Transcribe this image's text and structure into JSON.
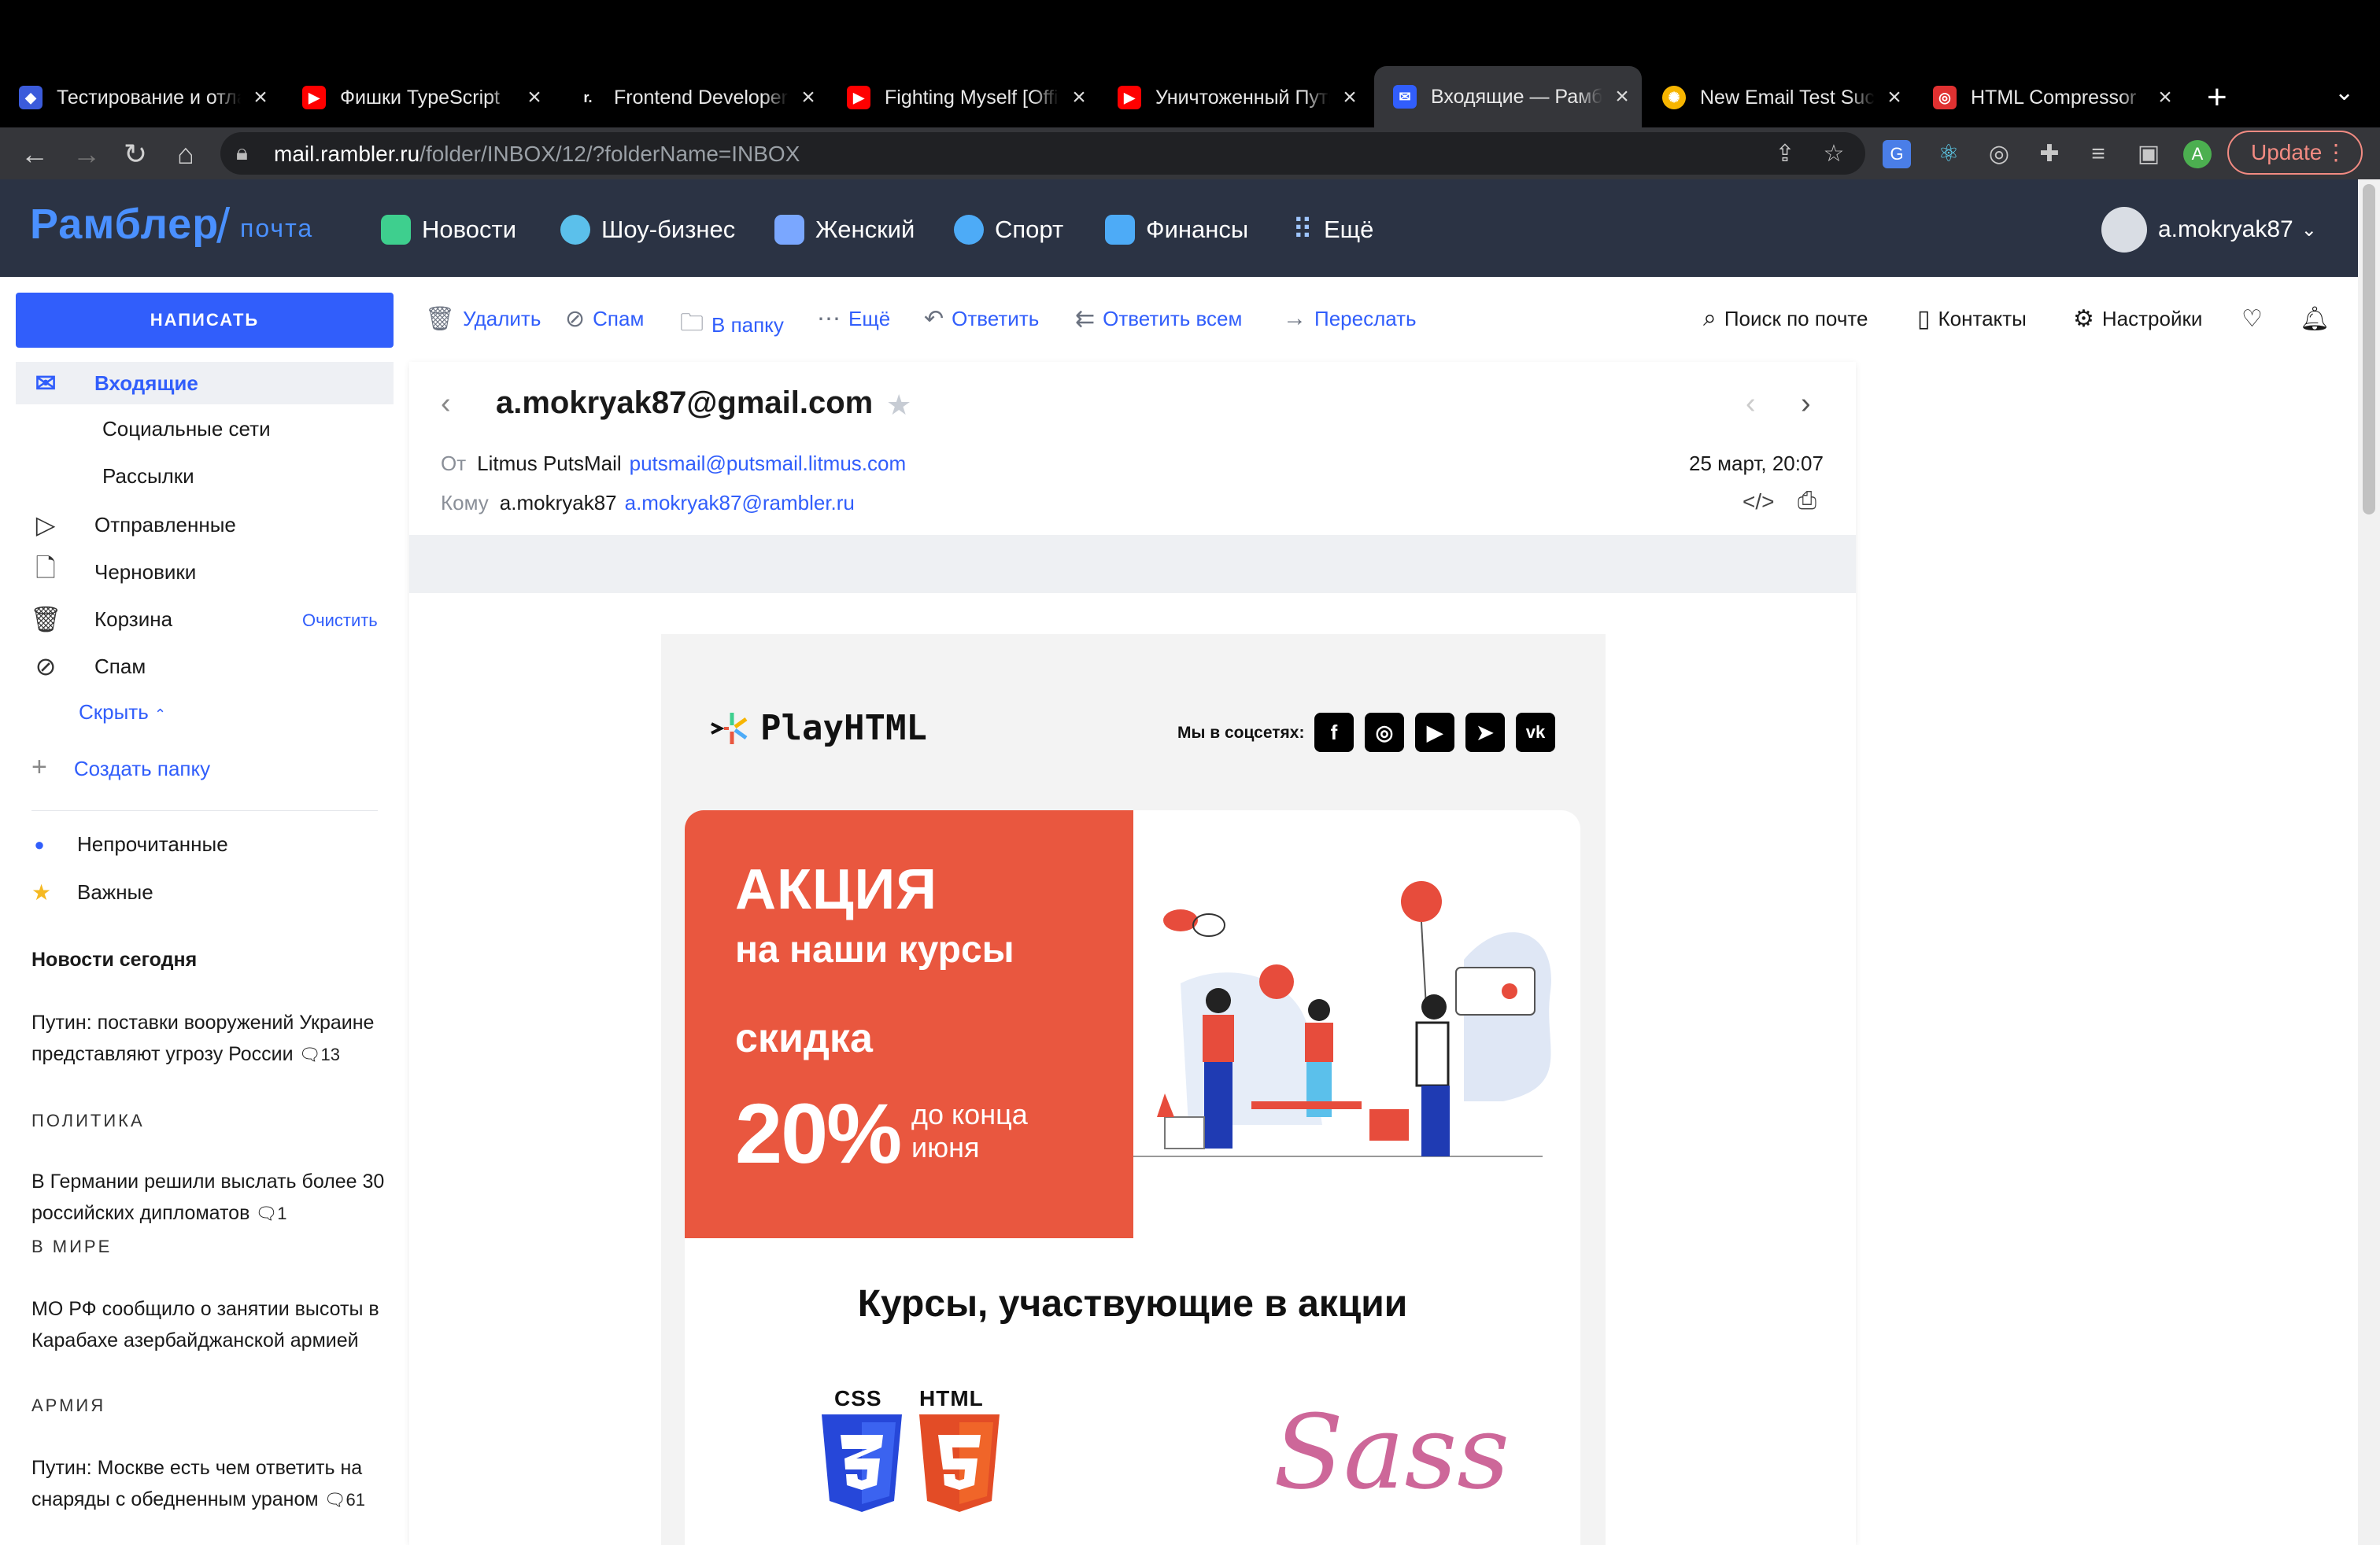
{
  "browser": {
    "tabs": [
      {
        "title": "Тестирование и отладка",
        "favicon": "shield-icon",
        "color": "#3b5bdb",
        "active": false
      },
      {
        "title": "Фишки TypeScript",
        "favicon": "youtube-icon",
        "color": "#ff0000",
        "active": false
      },
      {
        "title": "Frontend Developer",
        "favicon": "r-icon",
        "color": "#000000",
        "active": false
      },
      {
        "title": "Fighting Myself [Official]",
        "favicon": "youtube-icon",
        "color": "#ff0000",
        "active": false
      },
      {
        "title": "Уничтоженный Путин",
        "favicon": "youtube-icon",
        "color": "#ff0000",
        "active": false
      },
      {
        "title": "Входящие — Рамблер",
        "favicon": "mail-icon",
        "color": "#315efb",
        "active": true
      },
      {
        "title": "New Email Test Success",
        "favicon": "litmus-icon",
        "color": "#f7b500",
        "active": false
      },
      {
        "title": "HTML Compressor",
        "favicon": "compress-icon",
        "color": "#e03131",
        "active": false
      }
    ],
    "new_tab": "+",
    "url_host": "mail.rambler.ru",
    "url_path": "/folder/INBOX/12/?folderName=INBOX",
    "profile_initial": "A",
    "update_label": "Update"
  },
  "header": {
    "logo": "Рамблер",
    "logo_sub": "почта",
    "nav": [
      {
        "label": "Новости",
        "icon": "news-icon",
        "color": "#3ecf8e"
      },
      {
        "label": "Шоу-бизнес",
        "icon": "microphone-icon",
        "color": "#5bc0eb"
      },
      {
        "label": "Женский",
        "icon": "crown-icon",
        "color": "#7aa7ff"
      },
      {
        "label": "Спорт",
        "icon": "ball-icon",
        "color": "#4dabf7"
      },
      {
        "label": "Финансы",
        "icon": "wallet-icon",
        "color": "#4dabf7"
      },
      {
        "label": "Ещё",
        "icon": "grid-icon",
        "color": "#9ec5ff"
      }
    ],
    "user": "a.mokryak87"
  },
  "sidebar": {
    "compose": "НАПИСАТЬ",
    "folders": [
      {
        "label": "Входящие",
        "icon": "inbox-icon"
      },
      {
        "label": "Отправленные",
        "icon": "sent-icon"
      },
      {
        "label": "Черновики",
        "icon": "draft-icon"
      },
      {
        "label": "Корзина",
        "icon": "trash-icon"
      },
      {
        "label": "Спам",
        "icon": "spam-icon"
      }
    ],
    "subfolders": [
      "Социальные сети",
      "Рассылки"
    ],
    "clear": "Очистить",
    "hide": "Скрыть",
    "create_folder": "Создать папку",
    "filters": [
      "Непрочитанные",
      "Важные"
    ],
    "news_title": "Новости сегодня",
    "news": [
      {
        "text": "Путин: поставки вооружений Украине представляют угрозу России",
        "comments": "13",
        "category": "ПОЛИТИКА"
      },
      {
        "text": "В Германии решили выслать более 30 российских дипломатов",
        "comments": "1",
        "category": "В МИРЕ"
      },
      {
        "text": "МО РФ сообщило о занятии высоты в Карабахе азербайджанской армией",
        "comments": "",
        "category": "АРМИЯ"
      },
      {
        "text": "Путин: Москве есть чем ответить на снаряды с обедненным ураном",
        "comments": "61",
        "category": ""
      }
    ]
  },
  "toolbar": {
    "actions": [
      "Удалить",
      "Спам",
      "В папку",
      "Ещё",
      "Ответить",
      "Ответить всем",
      "Переслать"
    ],
    "right": [
      "Поиск по почте",
      "Контакты",
      "Настройки"
    ]
  },
  "message": {
    "subject": "a.mokryak87@gmail.com",
    "from_label": "От",
    "from_name": "Litmus PutsMail",
    "from_email": "putsmail@putsmail.litmus.com",
    "to_label": "Кому",
    "to_name": "a.mokryak87",
    "to_email": "a.mokryak87@rambler.ru",
    "date": "25 март, 20:07"
  },
  "email": {
    "brand": "PlayHTML",
    "social_label": "Мы в соцсетях:",
    "social": [
      "facebook-icon",
      "instagram-icon",
      "youtube-icon",
      "telegram-icon",
      "vk-icon"
    ],
    "promo_title": "АКЦИЯ",
    "promo_sub": "на наши курсы",
    "promo_discount": "скидка",
    "promo_percent": "20%",
    "promo_until": "до конца июня",
    "courses_title": "Курсы, участвующие в акции",
    "css_label": "CSS",
    "html_label": "HTML",
    "sass_label": "Sass",
    "accent": "#e9573f"
  }
}
